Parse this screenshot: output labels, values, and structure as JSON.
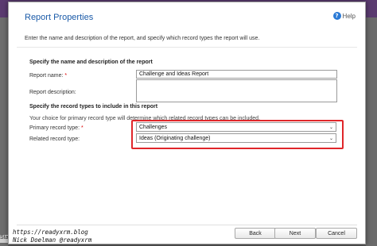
{
  "background": {
    "status_text": "Sta"
  },
  "dialog": {
    "title": "Report Properties",
    "help_label": "Help",
    "instructions": "Enter the name and description of the report, and specify which record types the report will use.",
    "section1_title": "Specify the name and description of the report",
    "report_name_label": "Report name:",
    "report_name_value": "Challenge and Ideas Report",
    "report_description_label": "Report description:",
    "report_description_value": "",
    "section2_title": "Specify the record types to include in this report",
    "record_type_note": "Your choice for primary record type will determine which related record types can be included.",
    "primary_record_type_label": "Primary record type:",
    "primary_record_type_value": "Challenges",
    "related_record_type_label": "Related record type:",
    "related_record_type_value": "Ideas (Originating challenge)",
    "buttons": {
      "back": "Back",
      "next": "Next",
      "cancel": "Cancel"
    }
  },
  "watermark": {
    "url": "https://readyxrm.blog",
    "author": "Nick Doelman @readyxrm"
  },
  "colors": {
    "title": "#1a5aa8",
    "highlight": "#e0262a",
    "required": "#d00000"
  }
}
